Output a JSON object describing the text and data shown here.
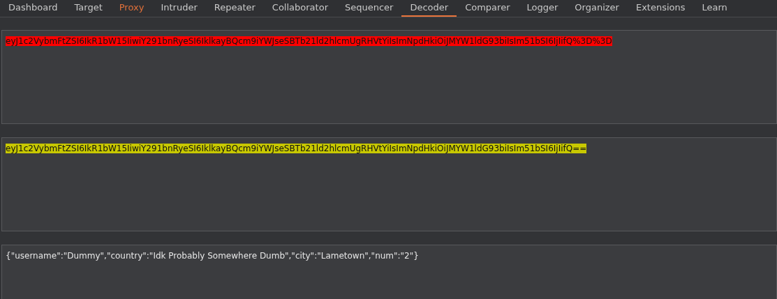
{
  "tabs": [
    {
      "label": "Dashboard",
      "selected": false,
      "alert": false
    },
    {
      "label": "Target",
      "selected": false,
      "alert": false
    },
    {
      "label": "Proxy",
      "selected": false,
      "alert": true
    },
    {
      "label": "Intruder",
      "selected": false,
      "alert": false
    },
    {
      "label": "Repeater",
      "selected": false,
      "alert": false
    },
    {
      "label": "Collaborator",
      "selected": false,
      "alert": false
    },
    {
      "label": "Sequencer",
      "selected": false,
      "alert": false
    },
    {
      "label": "Decoder",
      "selected": true,
      "alert": false
    },
    {
      "label": "Comparer",
      "selected": false,
      "alert": false
    },
    {
      "label": "Logger",
      "selected": false,
      "alert": false
    },
    {
      "label": "Organizer",
      "selected": false,
      "alert": false
    },
    {
      "label": "Extensions",
      "selected": false,
      "alert": false
    },
    {
      "label": "Learn",
      "selected": false,
      "alert": false
    }
  ],
  "panels": [
    {
      "text": "eyJ1c2VybmFtZSI6IkR1bW15IiwiY291bnRyeSI6IklkayBQcm9iYWJseSBTb21ld2hlcmUgRHVtYiIsImNpdHkiOiJMYW1ldG93biIsIm51bSI6IjIifQ%3D%3D",
      "color": "#ff0000"
    },
    {
      "text": "eyJ1c2VybmFtZSI6IkR1bW15IiwiY291bnRyeSI6IklkayBQcm9iYWJseSBTb21ld2hlcmUgRHVtYiIsImNpdHkiOiJMYW1ldG93biIsIm51bSI6IjIifQ==",
      "color": "#c8c800"
    },
    {
      "text": "{\"username\":\"Dummy\",\"country\":\"Idk Probably Somewhere Dumb\",\"city\":\"Lametown\",\"num\":\"2\"}"
    }
  ]
}
